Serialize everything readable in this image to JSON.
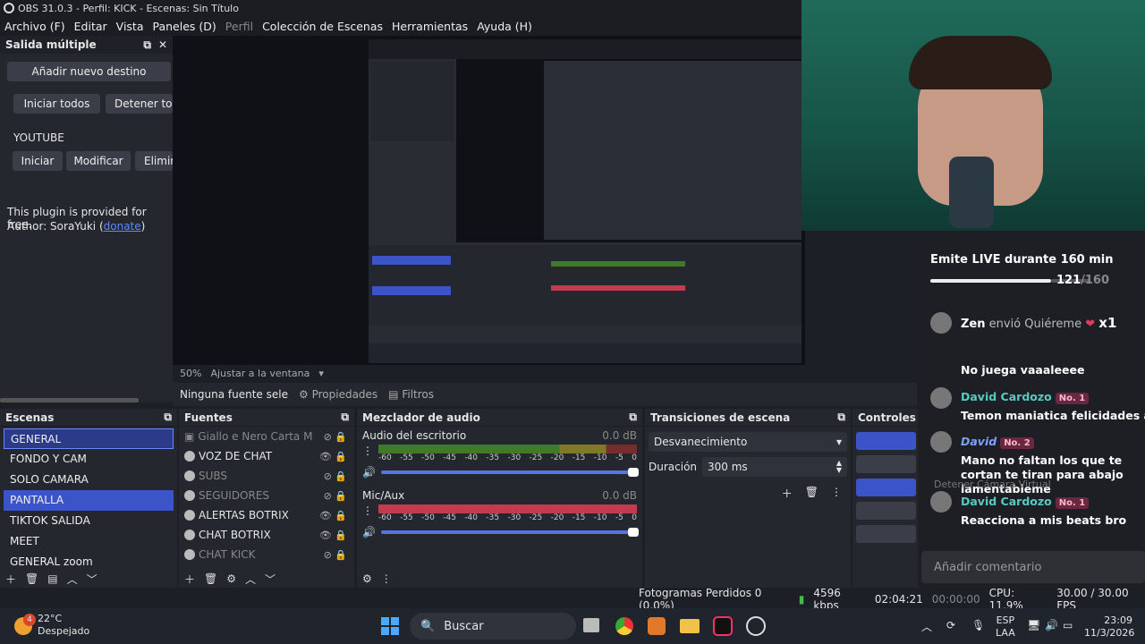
{
  "window_title": "OBS 31.0.3 - Perfil: KICK - Escenas: Sin Título",
  "menu": [
    "Archivo (F)",
    "Editar",
    "Vista",
    "Paneles (D)",
    "Perfil",
    "Colección de Escenas",
    "Herramientas",
    "Ayuda (H)"
  ],
  "multi_output": {
    "title": "Salida múltiple",
    "add_destination": "Añadir nuevo destino",
    "start_all": "Iniciar todos",
    "stop_all": "Detener tod",
    "destination_name": "YOUTUBE",
    "start": "Iniciar",
    "modify": "Modificar",
    "delete": "Elimir",
    "note_line1": "This plugin is provided for free.",
    "note_author": "Author: SoraYuki (",
    "donate": "donate",
    "note_close": ")"
  },
  "preview_bar": {
    "zoom": "50%",
    "fit": "Ajustar a la ventana"
  },
  "source_bar": {
    "no_source": "Ninguna fuente sele",
    "properties": "Propiedades",
    "filters": "Filtros"
  },
  "scenes": {
    "title": "Escenas",
    "items": [
      "GENERAL",
      "FONDO Y CAM",
      "SOLO CAMARA",
      "PANTALLA",
      "TIKTOK SALIDA",
      "MEET",
      "GENERAL zoom"
    ],
    "selected_index": 3,
    "outlined_index": 0
  },
  "sources": {
    "title": "Fuentes",
    "items": [
      {
        "name": "Giallo e Nero Carta Massi",
        "visible": false
      },
      {
        "name": "VOZ DE CHAT",
        "visible": true
      },
      {
        "name": "SUBS",
        "visible": false
      },
      {
        "name": "SEGUIDORES",
        "visible": false
      },
      {
        "name": "ALERTAS BOTRIX",
        "visible": true
      },
      {
        "name": "CHAT BOTRIX",
        "visible": true
      },
      {
        "name": "CHAT KICK",
        "visible": false
      }
    ]
  },
  "mixer": {
    "title": "Mezclador de audio",
    "channels": [
      {
        "name": "Audio del escritorio",
        "db": "0.0 dB"
      },
      {
        "name": "Mic/Aux",
        "db": "0.0 dB"
      }
    ],
    "ticks": [
      "-60",
      "-55",
      "-50",
      "-45",
      "-40",
      "-35",
      "-30",
      "-25",
      "-20",
      "-15",
      "-10",
      "-5",
      "0"
    ]
  },
  "transitions": {
    "title": "Transiciones de escena",
    "selected": "Desvanecimiento",
    "duration_label": "Duración",
    "duration_value": "300 ms"
  },
  "controls": {
    "title": "Controles"
  },
  "status": {
    "dropped": "Fotogramas Perdidos 0 (0.0%)",
    "kbps": "4596 kbps",
    "time": "02:04:21",
    "rec_time": "00:00:00",
    "cpu": "CPU: 11.9%",
    "fps": "30.00 / 30.00 FPS"
  },
  "overlay_chat": {
    "goal_title": "Emite LIVE durante 160 min",
    "goal_progress": 0.756,
    "goal_count": "121",
    "goal_total": "/160",
    "gift_user": "Zen",
    "gift_text": "envió Quiéreme",
    "gift_mult": "x1",
    "messages": [
      {
        "user": "",
        "badge": "",
        "text": "No juega vaaaleeee"
      },
      {
        "user": "David Cardozo",
        "badge": "No. 1",
        "text": "Temon maniatica felicidades axe"
      },
      {
        "user": "David",
        "badge": "No. 2",
        "text": "Mano no faltan los que te cortan te tiran para abajo lamentableme"
      },
      {
        "user": "David Cardozo",
        "badge": "No. 1",
        "text": "Reacciona a mis beats bro"
      }
    ],
    "ghost_text": "Detener Cámara Virtual",
    "comment_placeholder": "Añadir comentario"
  },
  "taskbar": {
    "temp": "22°C",
    "weather": "Despejado",
    "weather_badge": "4",
    "search": "Buscar",
    "lang1": "ESP",
    "lang2": "LAA",
    "clock_time": "23:09",
    "clock_date": "11/3/2026"
  },
  "colors": {
    "accent": "#3b55c8",
    "chat_name": "#59c9c2",
    "meter_red": "#c43a4e"
  }
}
